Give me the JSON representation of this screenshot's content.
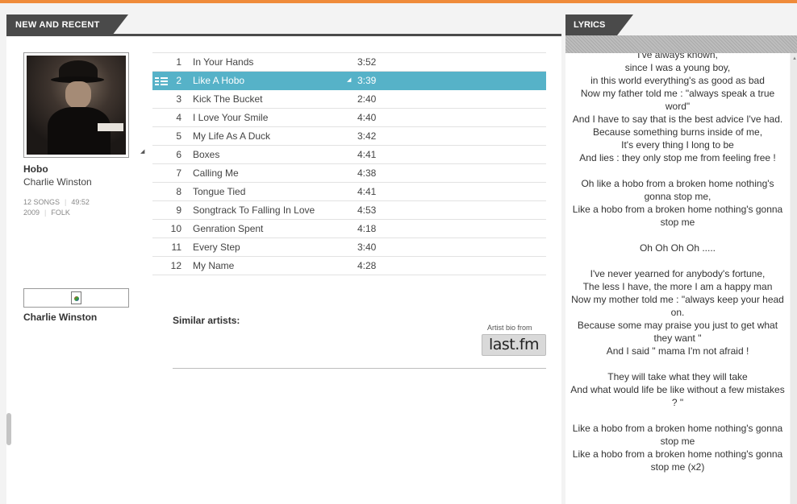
{
  "left_panel": {
    "tab_label": "NEW AND RECENT",
    "album": {
      "title": "Hobo",
      "artist": "Charlie Winston",
      "songs": "12 SONGS",
      "duration": "49:52",
      "year": "2009",
      "genre": "FOLK",
      "cover_icon": "album-cover-image"
    },
    "artist_image": {
      "icon": "broken-image-icon",
      "name": "Charlie Winston"
    },
    "tracks": [
      {
        "num": "1",
        "title": "In Your Hands",
        "duration": "3:52"
      },
      {
        "num": "2",
        "title": "Like A Hobo",
        "duration": "3:39",
        "selected": true
      },
      {
        "num": "3",
        "title": "Kick The Bucket",
        "duration": "2:40"
      },
      {
        "num": "4",
        "title": "I Love Your Smile",
        "duration": "4:40"
      },
      {
        "num": "5",
        "title": "My Life As A Duck",
        "duration": "3:42"
      },
      {
        "num": "6",
        "title": "Boxes",
        "duration": "4:41"
      },
      {
        "num": "7",
        "title": "Calling Me",
        "duration": "4:38"
      },
      {
        "num": "8",
        "title": "Tongue Tied",
        "duration": "4:41"
      },
      {
        "num": "9",
        "title": "Songtrack To Falling In Love",
        "duration": "4:53"
      },
      {
        "num": "10",
        "title": "Genration Spent",
        "duration": "4:18"
      },
      {
        "num": "11",
        "title": "Every Step",
        "duration": "3:40"
      },
      {
        "num": "12",
        "title": "My Name",
        "duration": "4:28"
      }
    ],
    "similar_artists_label": "Similar artists:",
    "bio_from_label": "Artist bio from",
    "lastfm_label": "last.fm"
  },
  "right_panel": {
    "tab_label": "LYRICS",
    "lyrics": "I've always known,\nsince I was a young boy,\nin this world everything's as good as bad\nNow my father told me : \"always speak a true word\"\nAnd I have to say that is the best advice I've had.\nBecause something burns inside of me,\nIt's every thing I long to be\nAnd lies : they only stop me from feeling free !\n\nOh like a hobo from a broken home nothing's gonna stop me,\nLike a hobo from a broken home nothing's gonna stop me\n\nOh Oh Oh Oh .....\n\nI've never yearned for anybody's fortune,\nThe less I have, the more I am a happy man\nNow my mother told me : \"always keep your head on.\nBecause some may praise you just to get what they want \"\nAnd I said \" mama I'm not afraid !\n\nThey will take what they will take\nAnd what would life be like without a few mistakes ? \"\n\nLike a hobo from a broken home nothing's gonna stop me\nLike a hobo from a broken home nothing's gonna stop me (x2)"
  },
  "colors": {
    "accent_top": "#ef8b3a",
    "tab_bg": "#4a4a4a",
    "selected_row": "#56b2c8"
  }
}
